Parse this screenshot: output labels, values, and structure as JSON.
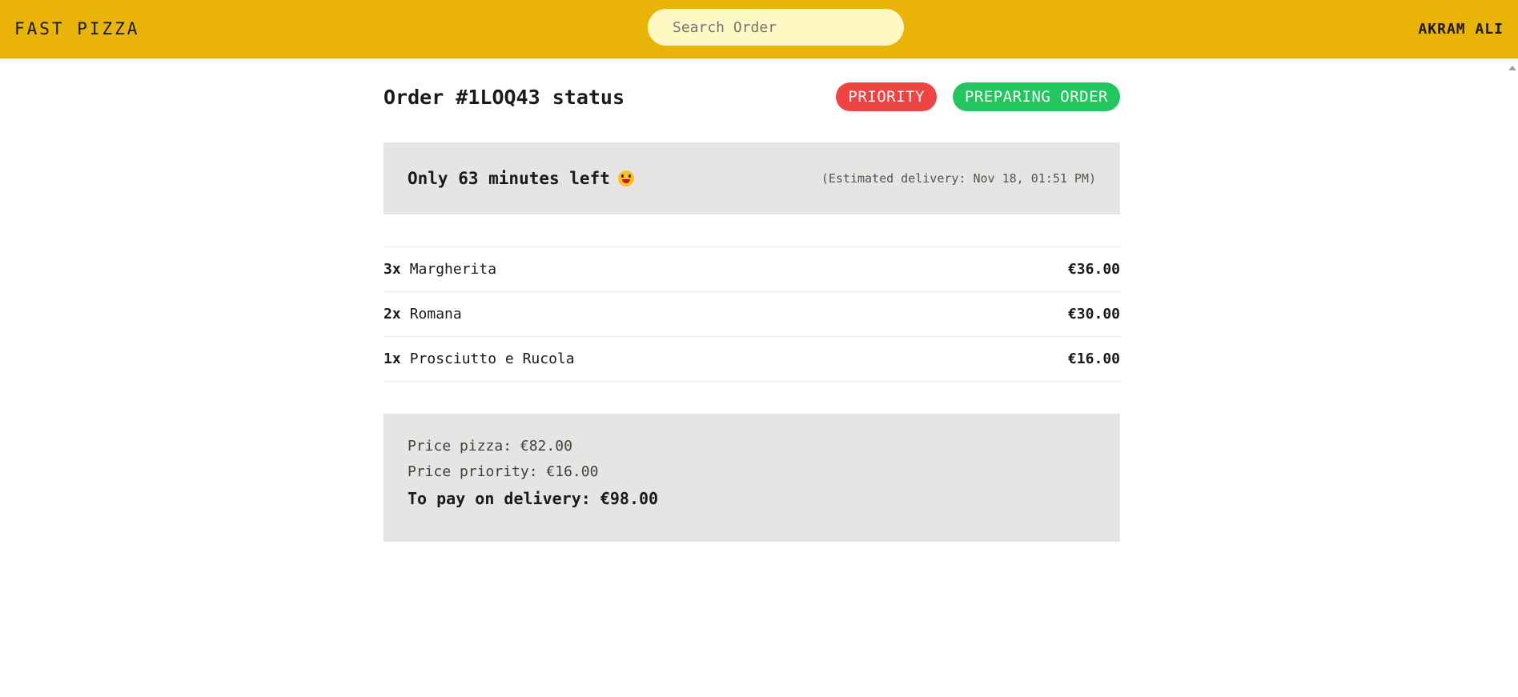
{
  "header": {
    "logo": "FAST PIZZA",
    "search_placeholder": "Search Order",
    "user": "AKRAM ALI"
  },
  "order": {
    "title": "Order #1LOQ43 status",
    "badges": {
      "priority": "PRIORITY",
      "status": "PREPARING ORDER"
    },
    "eta": {
      "message": "Only 63 minutes left",
      "emoji": "grinning-tongue-emoji",
      "estimated": "(Estimated delivery: Nov 18, 01:51 PM)"
    },
    "items": [
      {
        "qty": "3x",
        "name": "Margherita",
        "price": "€36.00"
      },
      {
        "qty": "2x",
        "name": "Romana",
        "price": "€30.00"
      },
      {
        "qty": "1x",
        "name": "Prosciutto e Rucola",
        "price": "€16.00"
      }
    ],
    "summary": {
      "price_pizza": "Price pizza: €82.00",
      "price_priority": "Price priority: €16.00",
      "to_pay": "To pay on delivery: €98.00"
    }
  },
  "colors": {
    "header_bg": "#eab308",
    "search_bg": "#fef9c3",
    "priority_badge": "#ef4444",
    "status_badge": "#22c55e",
    "panel_bg": "#e7e5e4"
  }
}
